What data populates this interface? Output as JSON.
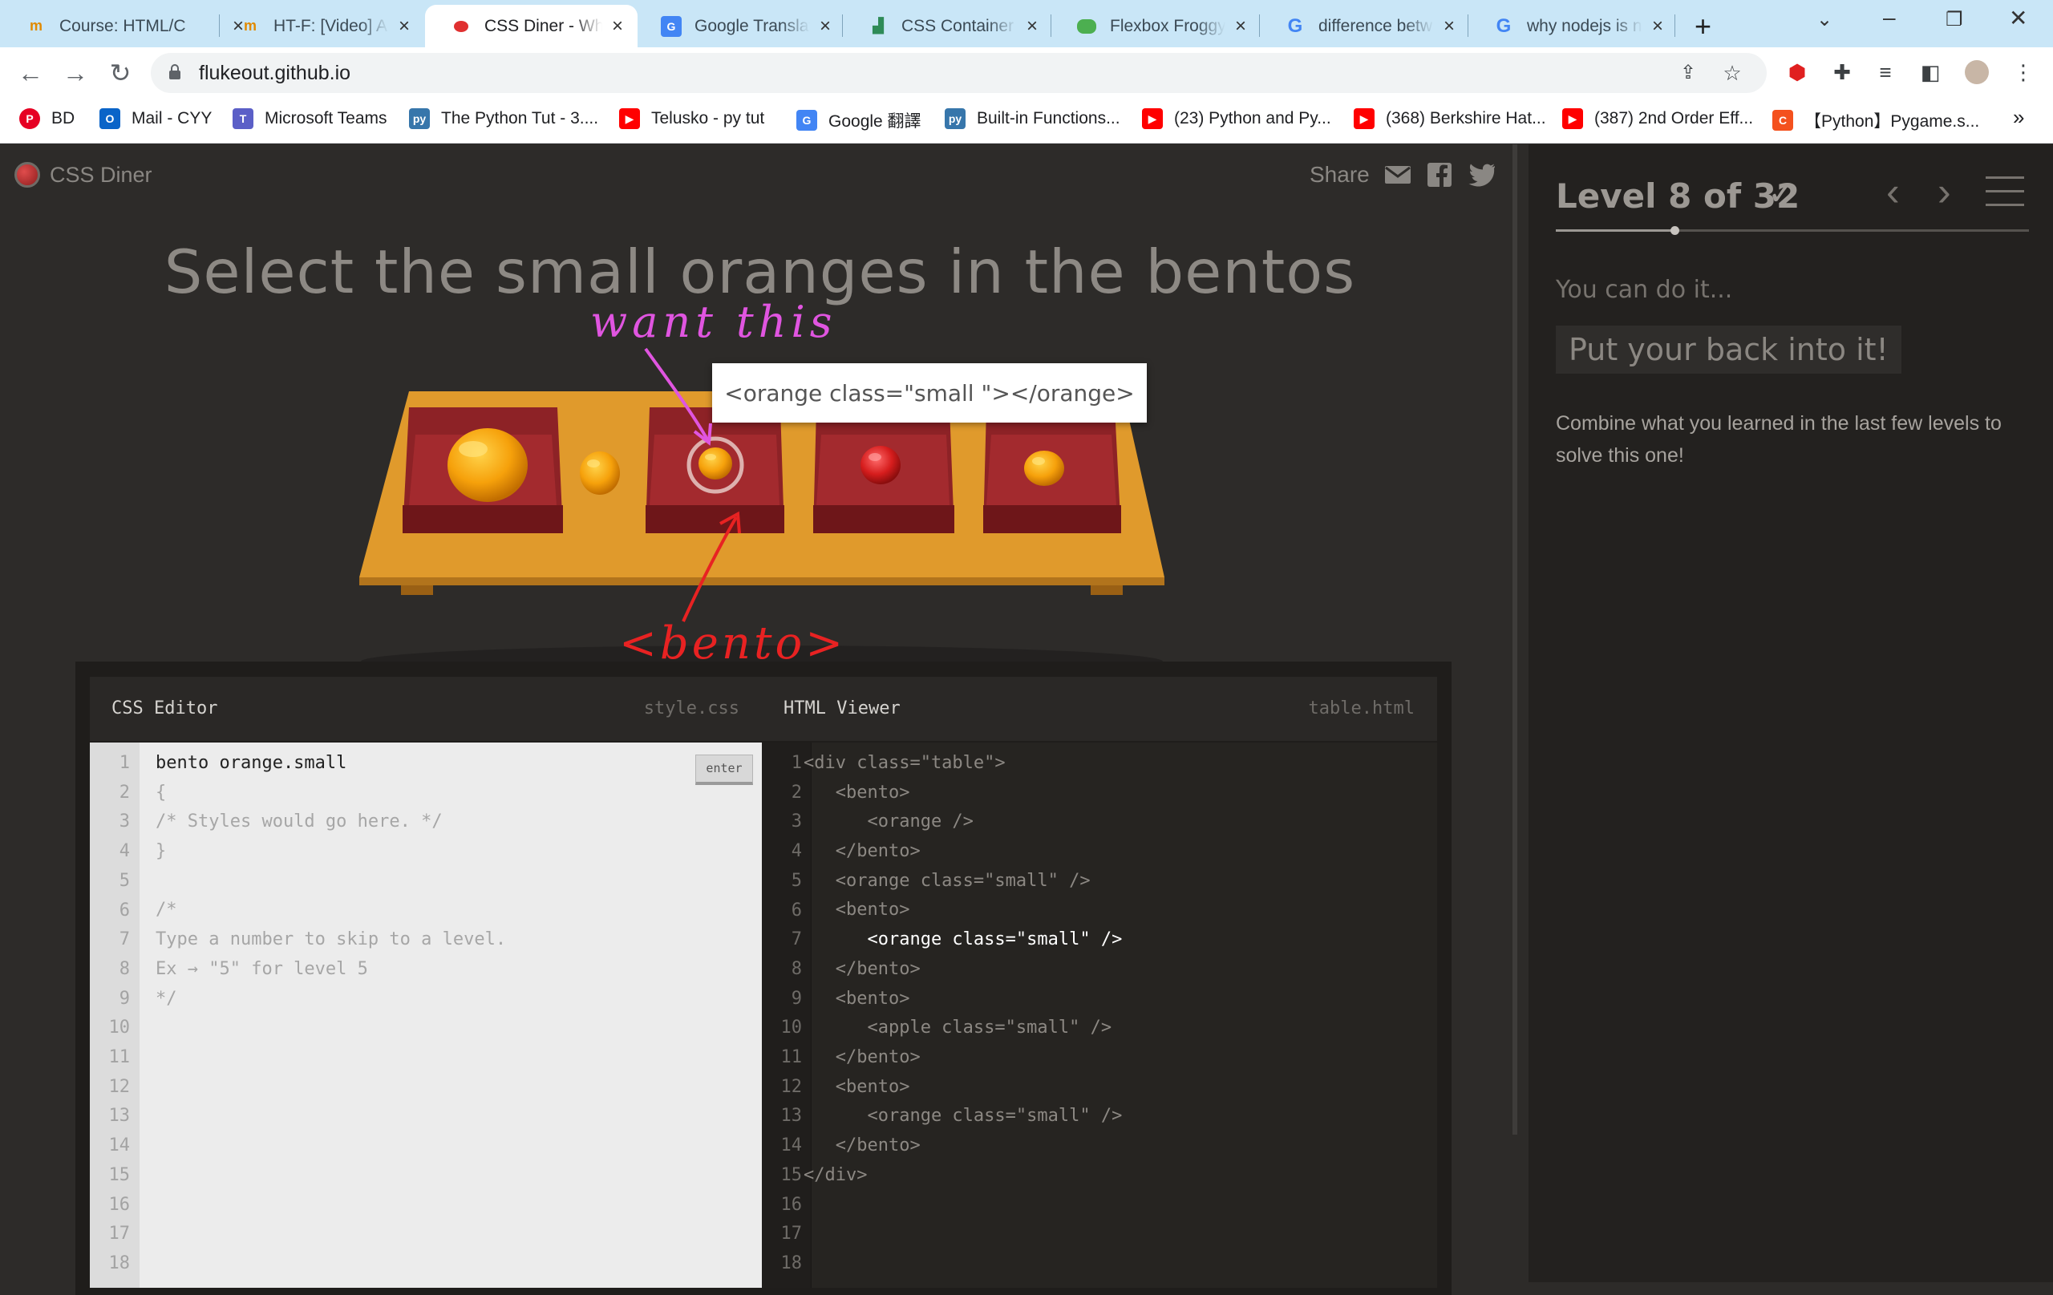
{
  "browser": {
    "tabs": [
      {
        "title": "Course: HTML/C",
        "icon": "moodle-hat-icon"
      },
      {
        "title": "HT-F: [Video] A",
        "icon": "moodle-hat-icon"
      },
      {
        "title": "CSS Diner - Wh",
        "icon": "css-diner-icon",
        "active": true
      },
      {
        "title": "Google Translat",
        "icon": "google-translate-icon"
      },
      {
        "title": "CSS Container (",
        "icon": "chart-icon"
      },
      {
        "title": "Flexbox Froggy",
        "icon": "frog-icon"
      },
      {
        "title": "difference betw",
        "icon": "google-icon"
      },
      {
        "title": "why nodejs is n",
        "icon": "google-icon"
      }
    ],
    "url": "flukeout.github.io",
    "bookmarks": [
      {
        "label": "BD",
        "icon": "pinterest-icon"
      },
      {
        "label": "Mail - CYY",
        "icon": "outlook-icon"
      },
      {
        "label": "Microsoft Teams",
        "icon": "teams-icon"
      },
      {
        "label": "The Python Tut - 3....",
        "icon": "python-icon"
      },
      {
        "label": "Telusko - py tut",
        "icon": "youtube-icon"
      },
      {
        "label": "Google 翻譯",
        "icon": "google-translate-icon"
      },
      {
        "label": "Built-in Functions...",
        "icon": "python-icon"
      },
      {
        "label": "(23) Python and Py...",
        "icon": "youtube-icon"
      },
      {
        "label": "(368) Berkshire Hat...",
        "icon": "youtube-icon"
      },
      {
        "label": "(387) 2nd Order Eff...",
        "icon": "youtube-icon"
      },
      {
        "label": "【Python】Pygame.s...",
        "icon": "c-logo-icon"
      }
    ],
    "bookmarks_more": "»"
  },
  "page": {
    "logo_text": "CSS Diner",
    "share_label": "Share",
    "instruction": "Select the small oranges in the bentos",
    "tooltip": "<orange class=\"small \"></orange>",
    "annotations": {
      "want": "want this",
      "bento": "<bento>"
    }
  },
  "css_editor": {
    "title": "CSS Editor",
    "file": "style.css",
    "enter_label": "enter",
    "line_numbers": [
      "1",
      "2",
      "3",
      "4",
      "5",
      "6",
      "7",
      "8",
      "9",
      "10",
      "11",
      "12",
      "13",
      "14",
      "15",
      "16",
      "17",
      "18"
    ],
    "lines": [
      "bento orange.small",
      "{",
      "/* Styles would go here. */",
      "}",
      "",
      "/*",
      "Type a number to skip to a level.",
      "Ex → \"5\" for level 5",
      "*/"
    ]
  },
  "html_viewer": {
    "title": "HTML Viewer",
    "file": "table.html",
    "line_numbers": [
      "1",
      "2",
      "3",
      "4",
      "5",
      "6",
      "7",
      "8",
      "9",
      "10",
      "11",
      "12",
      "13",
      "14",
      "15",
      "16",
      "17",
      "18"
    ],
    "lines": [
      "<div class=\"table\">",
      "   <bento>",
      "      <orange />",
      "   </bento>",
      "   <orange class=\"small\" />",
      "   <bento>",
      "      <orange class=\"small\" />",
      "   </bento>",
      "   <bento>",
      "      <apple class=\"small\" />",
      "   </bento>",
      "   <bento>",
      "      <orange class=\"small\" />",
      "   </bento>",
      "</div>"
    ],
    "highlighted_line_index": 6
  },
  "sidebar": {
    "level_title": "Level 8 of 32",
    "current_level": 8,
    "total_levels": 32,
    "completed": true,
    "encouragement": "You can do it...",
    "level_name": "Put your back into it!",
    "description": "Combine what you learned in the last few levels to solve this one!"
  },
  "colors": {
    "page_bg": "#2d2b29",
    "sidebar_bg": "#23211f",
    "orange": "#f6a10b",
    "apple_red": "#d61d1d",
    "bento_red": "#8d2226",
    "table_wood": "#e09a2c",
    "annotation_pink": "#e055e0",
    "annotation_red": "#e82222"
  }
}
